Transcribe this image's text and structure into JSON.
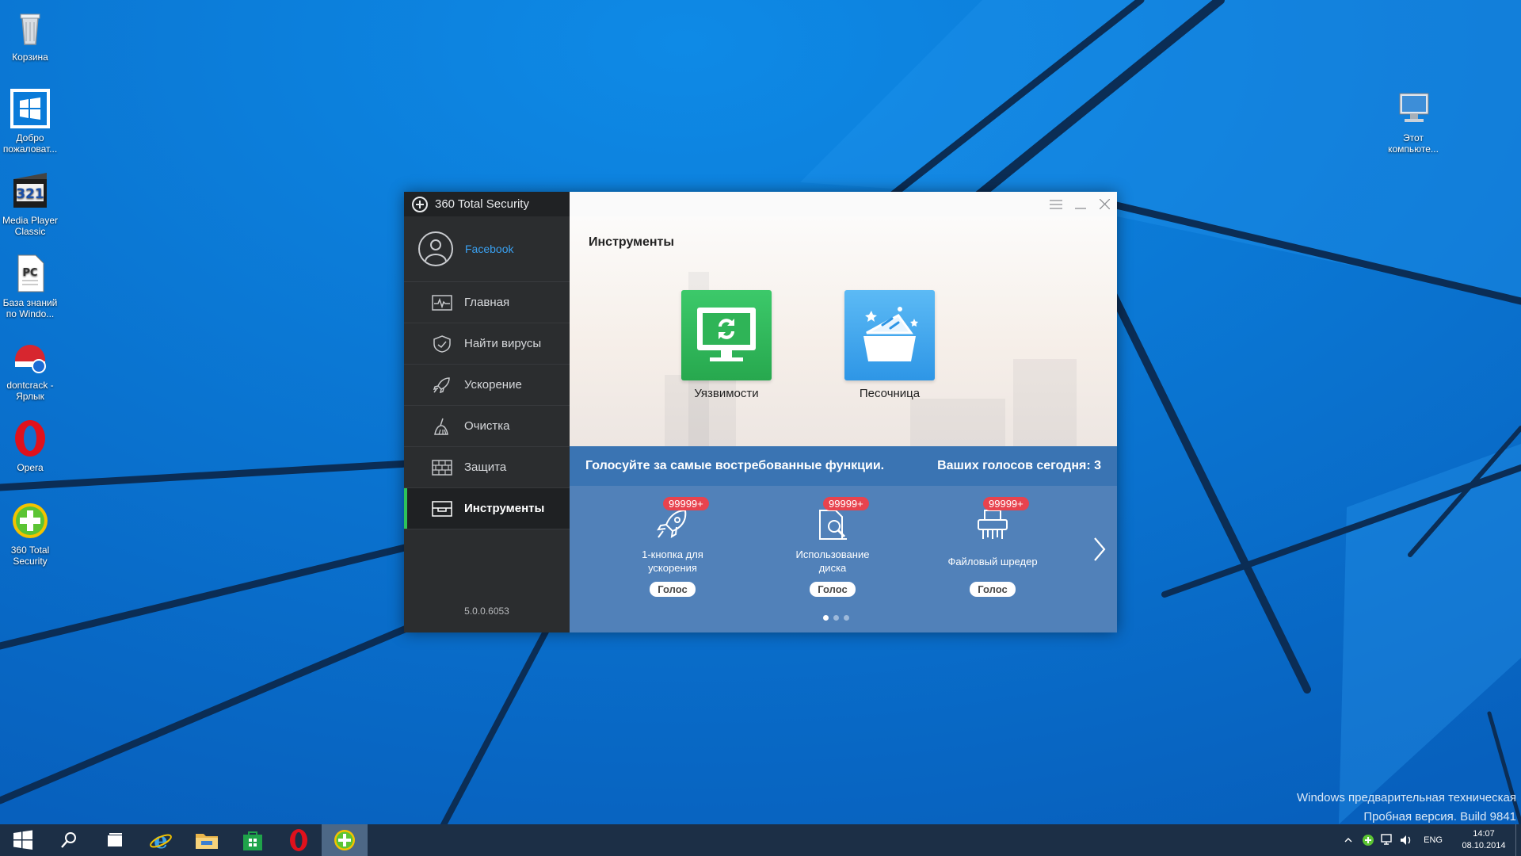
{
  "desktop": {
    "icons": [
      {
        "name": "Корзина",
        "icon": "recycle-bin-icon"
      },
      {
        "name": "Добро\nпожаловат...",
        "icon": "windows-welcome-icon"
      },
      {
        "name": "Media Player\nClassic",
        "icon": "media-player-classic-icon"
      },
      {
        "name": "База знаний\nпо Windo...",
        "icon": "knowledge-base-icon"
      },
      {
        "name": "dontcrack -\nЯрлык",
        "icon": "dontcrack-icon"
      },
      {
        "name": "Opera",
        "icon": "opera-icon"
      },
      {
        "name": "360 Total\nSecurity",
        "icon": "360-total-security-icon"
      },
      {
        "name": "Этот\nкомпьюте...",
        "icon": "this-computer-icon"
      }
    ],
    "watermark": [
      "Windows предварительная техническая",
      "Пробная версия. Build 9841"
    ]
  },
  "app": {
    "title": "360 Total Security",
    "account": "Facebook",
    "nav": [
      {
        "label": "Главная",
        "icon": "pulse-monitor-icon"
      },
      {
        "label": "Найти вирусы",
        "icon": "shield-scan-icon"
      },
      {
        "label": "Ускорение",
        "icon": "rocket-icon"
      },
      {
        "label": "Очистка",
        "icon": "broom-icon"
      },
      {
        "label": "Защита",
        "icon": "firewall-icon"
      },
      {
        "label": "Инструменты",
        "icon": "toolbox-icon",
        "active": true
      }
    ],
    "version": "5.0.0.6053",
    "page_title": "Инструменты",
    "tools": [
      {
        "label": "Уязвимости",
        "icon": "vulnerability-monitor-icon",
        "color": "#2fb457"
      },
      {
        "label": "Песочница",
        "icon": "sandbox-box-icon",
        "color": "#3ba4ee"
      }
    ],
    "vote": {
      "prompt": "Голосуйте за самые востребованные функции.",
      "votes_today": "Ваших голосов сегодня: 3",
      "cards": [
        {
          "badge": "99999+",
          "label": "1-кнопка для\nускорения",
          "button": "Голос",
          "icon": "rocket-icon"
        },
        {
          "badge": "99999+",
          "label": "Использование\nдиска",
          "button": "Голос",
          "icon": "disk-usage-icon"
        },
        {
          "badge": "99999+",
          "label": "Файловый шредер",
          "button": "Голос",
          "icon": "shredder-icon"
        }
      ],
      "page_count": 3,
      "current_page": 1
    }
  },
  "taskbar": {
    "language": "ENG",
    "time": "14:07",
    "date": "08.10.2014"
  }
}
